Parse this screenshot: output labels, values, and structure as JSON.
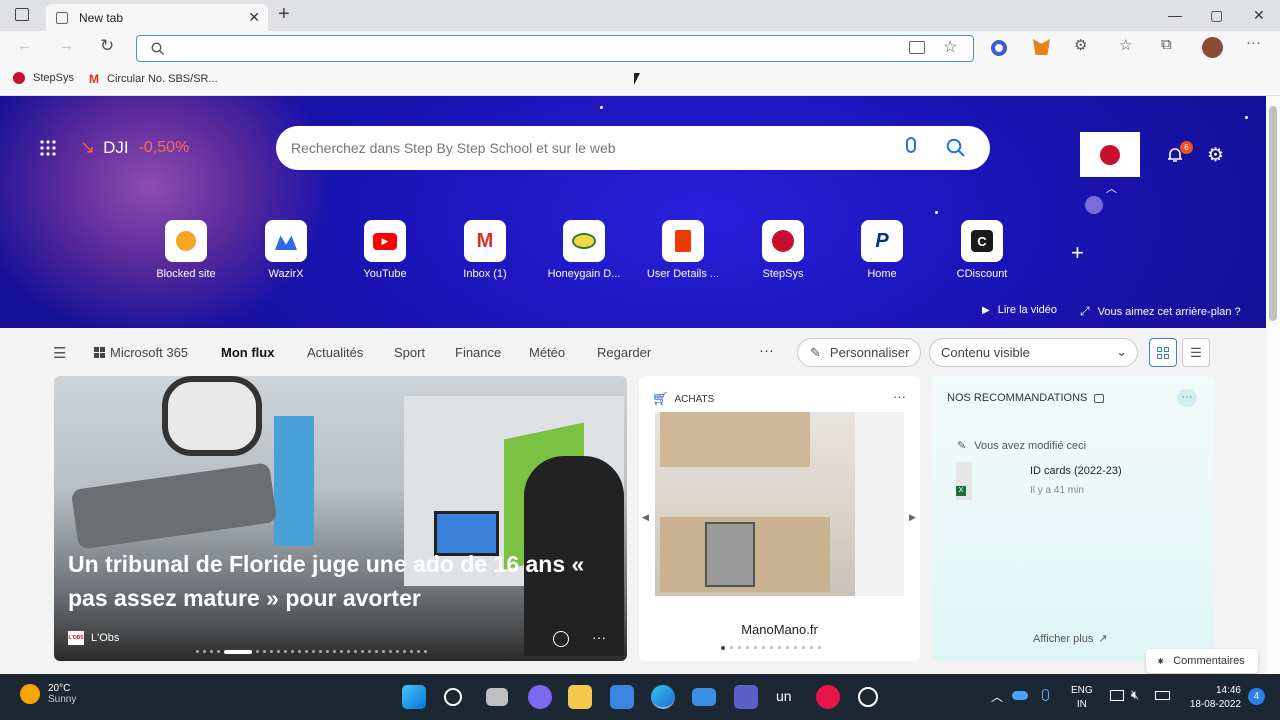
{
  "browser": {
    "tab_title": "New tab",
    "new_tab_symbol": "+",
    "close_symbol": "✕",
    "window_controls": {
      "minimize": "—",
      "maximize": "▢",
      "close": "✕"
    }
  },
  "bookmarks": [
    {
      "label": "StepSys"
    },
    {
      "label": "Circular No. SBS/SR..."
    }
  ],
  "hero": {
    "ticker_symbol": "DJI",
    "ticker_change": "-0,50%",
    "search_placeholder": "Recherchez dans Step By Step School et sur le web",
    "notifications_count": "6",
    "quick_links": [
      {
        "label": "Blocked site",
        "icon": "blocked-site-icon"
      },
      {
        "label": "WazirX",
        "icon": "wazirx-icon"
      },
      {
        "label": "YouTube",
        "icon": "youtube-icon"
      },
      {
        "label": "Inbox (1)",
        "icon": "gmail-icon"
      },
      {
        "label": "Honeygain D...",
        "icon": "honeygain-icon"
      },
      {
        "label": "User Details ...",
        "icon": "office-icon"
      },
      {
        "label": "StepSys",
        "icon": "stepsys-icon"
      },
      {
        "label": "Home",
        "icon": "paypal-icon"
      },
      {
        "label": "CDiscount",
        "icon": "cdiscount-icon"
      }
    ],
    "add_symbol": "+",
    "watch_video": "Lire la vidéo",
    "like_background": "Vous aimez cet arrière-plan ?"
  },
  "feed_nav": {
    "items": [
      "Microsoft 365",
      "Mon flux",
      "Actualités",
      "Sport",
      "Finance",
      "Météo",
      "Regarder"
    ],
    "more": "···",
    "personalize": "Personnaliser",
    "content_visible": "Contenu visible"
  },
  "main_story": {
    "headline": "Un tribunal de Floride juge une ado de 16 ans « pas assez mature » pour avorter",
    "source": "L'Obs",
    "source_logo": "L'OBS",
    "more": "···"
  },
  "shopping": {
    "label": "ACHATS",
    "more": "···",
    "merchant": "ManoMano.fr"
  },
  "recommendations": {
    "title": "NOS RECOMMANDATIONS",
    "more": "···",
    "modified_note": "Vous avez modifié ceci",
    "file_name": "ID cards (2022-23)",
    "file_time": "Il y a 41 min",
    "show_more": "Afficher plus"
  },
  "feedback": "Commentaires",
  "taskbar": {
    "temperature": "20°C",
    "weather": "Sunny",
    "lang_top": "ENG",
    "lang_bottom": "IN",
    "time": "14:46",
    "date": "18-08-2022",
    "notif_count": "4",
    "label_un": "un"
  }
}
